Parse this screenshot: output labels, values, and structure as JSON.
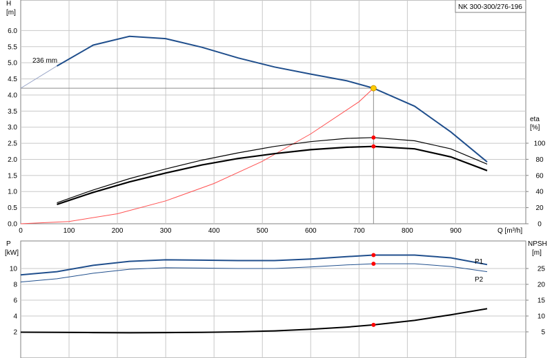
{
  "chart_data": [
    {
      "type": "line",
      "panel": "head-efficiency",
      "title": "NK 300-300/276-196",
      "xlabel": "Q [m³/h]",
      "ylabel_left": "H [m]",
      "ylabel_left_top": "H",
      "ylabel_left_unit": "[m]",
      "ylabel_right_top": "eta",
      "ylabel_right_unit": "[%]",
      "xlim": [
        0,
        1000
      ],
      "ylim_left": [
        0,
        6.5
      ],
      "ylim_right_ticks": [
        0,
        20,
        40,
        60,
        80,
        100
      ],
      "xticks": [
        "0",
        "100",
        "200",
        "300",
        "400",
        "500",
        "600",
        "700",
        "800",
        "900"
      ],
      "yticks_left": [
        "0.0",
        "0.5",
        "1.0",
        "1.5",
        "2.0",
        "2.5",
        "3.0",
        "3.5",
        "4.0",
        "4.5",
        "5.0",
        "5.5",
        "6.0"
      ],
      "yticks_right": [
        "0",
        "20",
        "40",
        "60",
        "80",
        "100"
      ],
      "grid": true,
      "annotation": "236 mm",
      "head_curve": {
        "x": [
          75,
          150,
          225,
          300,
          375,
          450,
          525,
          600,
          675,
          730,
          815,
          890,
          965
        ],
        "y": [
          4.9,
          5.55,
          5.82,
          5.75,
          5.48,
          5.15,
          4.87,
          4.65,
          4.44,
          4.21,
          3.65,
          2.85,
          1.92
        ]
      },
      "system_curve": {
        "x": [
          0,
          100,
          200,
          300,
          400,
          500,
          600,
          700,
          730
        ],
        "y": [
          0.0,
          0.07,
          0.31,
          0.71,
          1.25,
          1.94,
          2.79,
          3.79,
          4.21
        ]
      },
      "efficiency_upper": {
        "x": [
          75,
          150,
          225,
          300,
          375,
          450,
          525,
          600,
          675,
          730,
          815,
          890,
          965
        ],
        "y": [
          26,
          42,
          56,
          68,
          79,
          88,
          96,
          102,
          106,
          107,
          103,
          93,
          74
        ]
      },
      "efficiency_lower": {
        "x": [
          75,
          150,
          225,
          300,
          375,
          450,
          525,
          600,
          675,
          730,
          815,
          890,
          965
        ],
        "y": [
          24,
          39,
          52,
          63,
          73,
          81,
          87,
          92,
          95,
          96,
          93,
          83,
          66
        ]
      },
      "duty_point": {
        "x": 730,
        "y": 4.21
      },
      "efficiency_points": [
        {
          "x": 730,
          "y": 107
        },
        {
          "x": 730,
          "y": 96
        }
      ]
    },
    {
      "type": "line",
      "panel": "power-npsh",
      "ylabel_left_top": "P",
      "ylabel_left_unit": "[kW]",
      "ylabel_right_top": "NPSH",
      "ylabel_right_unit": "[m]",
      "xlim": [
        0,
        1000
      ],
      "ylim_left": [
        0,
        12.4
      ],
      "ylim_right": [
        0,
        30
      ],
      "yticks_left": [
        "2",
        "4",
        "6",
        "8",
        "10"
      ],
      "yticks_right": [
        "5",
        "10",
        "15",
        "20",
        "25"
      ],
      "grid": true,
      "P1": {
        "name": "P1",
        "x": [
          0,
          75,
          150,
          225,
          300,
          375,
          450,
          525,
          600,
          675,
          730,
          815,
          890,
          965
        ],
        "y": [
          9.2,
          9.6,
          10.4,
          10.9,
          11.1,
          11.05,
          11.0,
          11.0,
          11.2,
          11.5,
          11.7,
          11.7,
          11.35,
          10.5
        ]
      },
      "P2": {
        "name": "P2",
        "x": [
          0,
          75,
          150,
          225,
          300,
          375,
          450,
          525,
          600,
          675,
          730,
          815,
          890,
          965
        ],
        "y": [
          8.3,
          8.7,
          9.4,
          9.9,
          10.1,
          10.05,
          10.0,
          10.0,
          10.2,
          10.45,
          10.6,
          10.6,
          10.25,
          9.6
        ]
      },
      "NPSH": {
        "x": [
          0,
          75,
          150,
          225,
          300,
          375,
          450,
          525,
          600,
          675,
          730,
          815,
          890,
          965
        ],
        "y": [
          4.9,
          4.85,
          4.75,
          4.7,
          4.75,
          4.85,
          5.0,
          5.3,
          5.8,
          6.5,
          7.2,
          8.6,
          10.4,
          12.3
        ]
      },
      "points": [
        {
          "series": "P1",
          "x": 730,
          "y": 11.7
        },
        {
          "series": "P2",
          "x": 730,
          "y": 10.6
        },
        {
          "series": "NPSH",
          "x": 730,
          "y": 7.2
        }
      ]
    }
  ],
  "colors": {
    "head": "#1f4e8c",
    "system": "#ff5050",
    "efficiency": "#000000",
    "grid": "#c8c8c8",
    "axis": "#808080",
    "point": "#ff0000",
    "duty": "#ffcc00"
  }
}
